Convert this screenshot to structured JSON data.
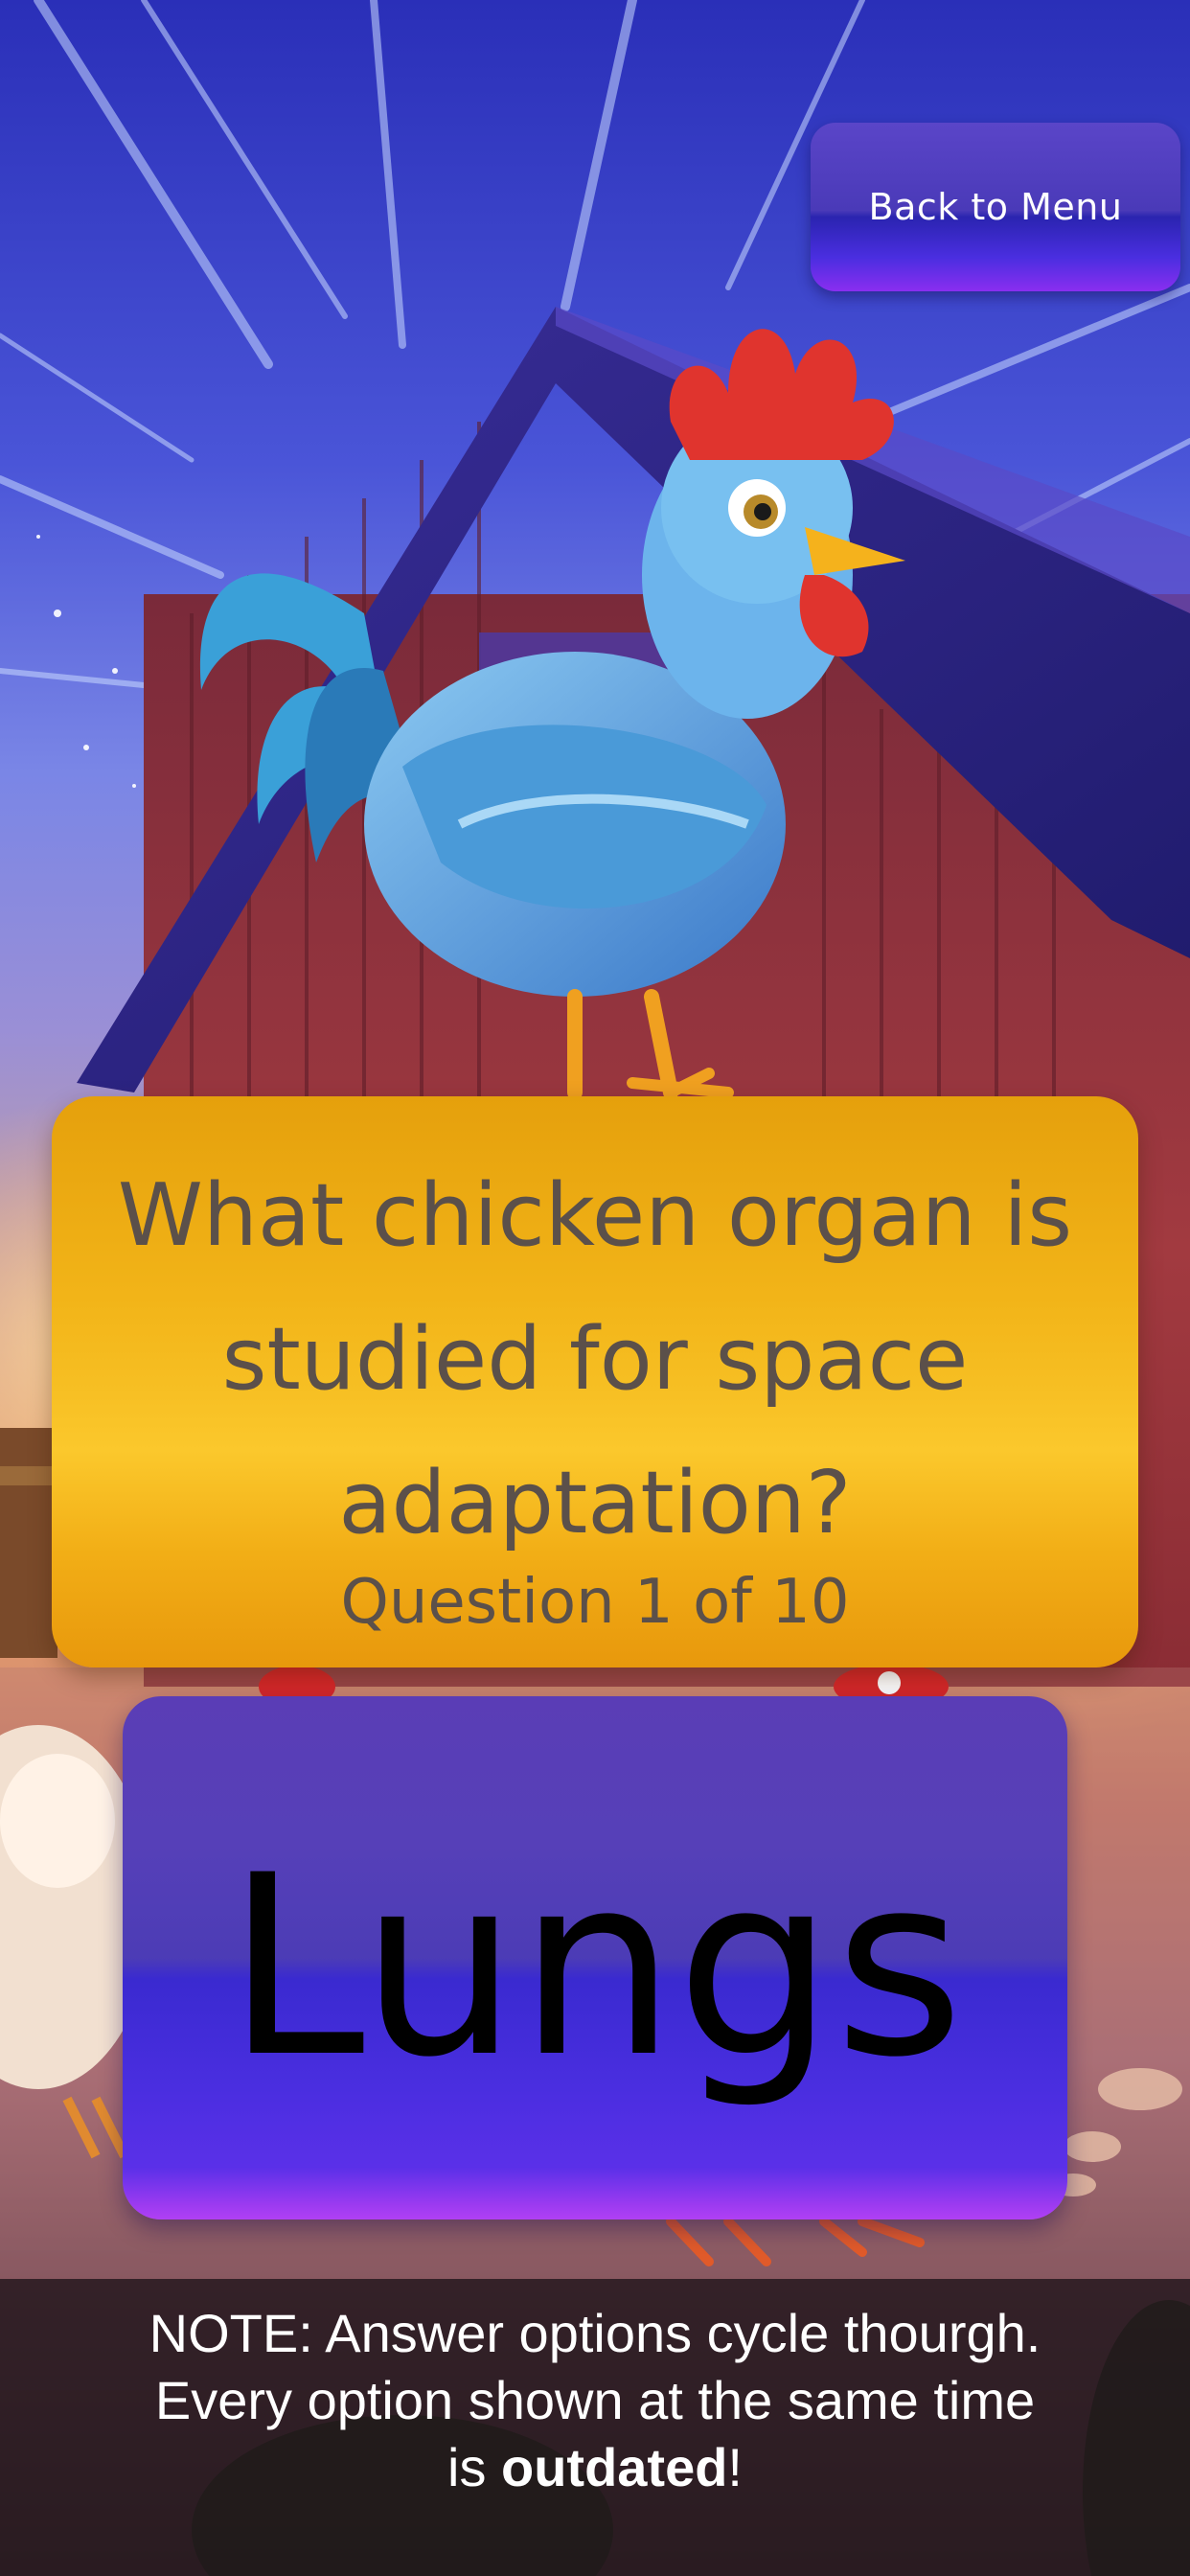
{
  "header": {
    "back_label": "Back to Menu"
  },
  "question": {
    "text": "What chicken organ is studied for space adaptation?",
    "counter": "Question 1 of 10"
  },
  "answer": {
    "option_label": "Lungs"
  },
  "note": {
    "line1": "NOTE: Answer options cycle thourgh.",
    "line2": "Every option shown at the same time",
    "line3_prefix": "is ",
    "line3_bold": "outdated",
    "line3_suffix": "!"
  },
  "illustration": {
    "icons": [
      "rooster-illustration",
      "barn-illustration",
      "hen-illustration"
    ]
  },
  "colors": {
    "question_card": "#f6be22",
    "answer_card": "#4a2ee0",
    "button": "#4a3ab8",
    "question_text": "#5b504a"
  }
}
